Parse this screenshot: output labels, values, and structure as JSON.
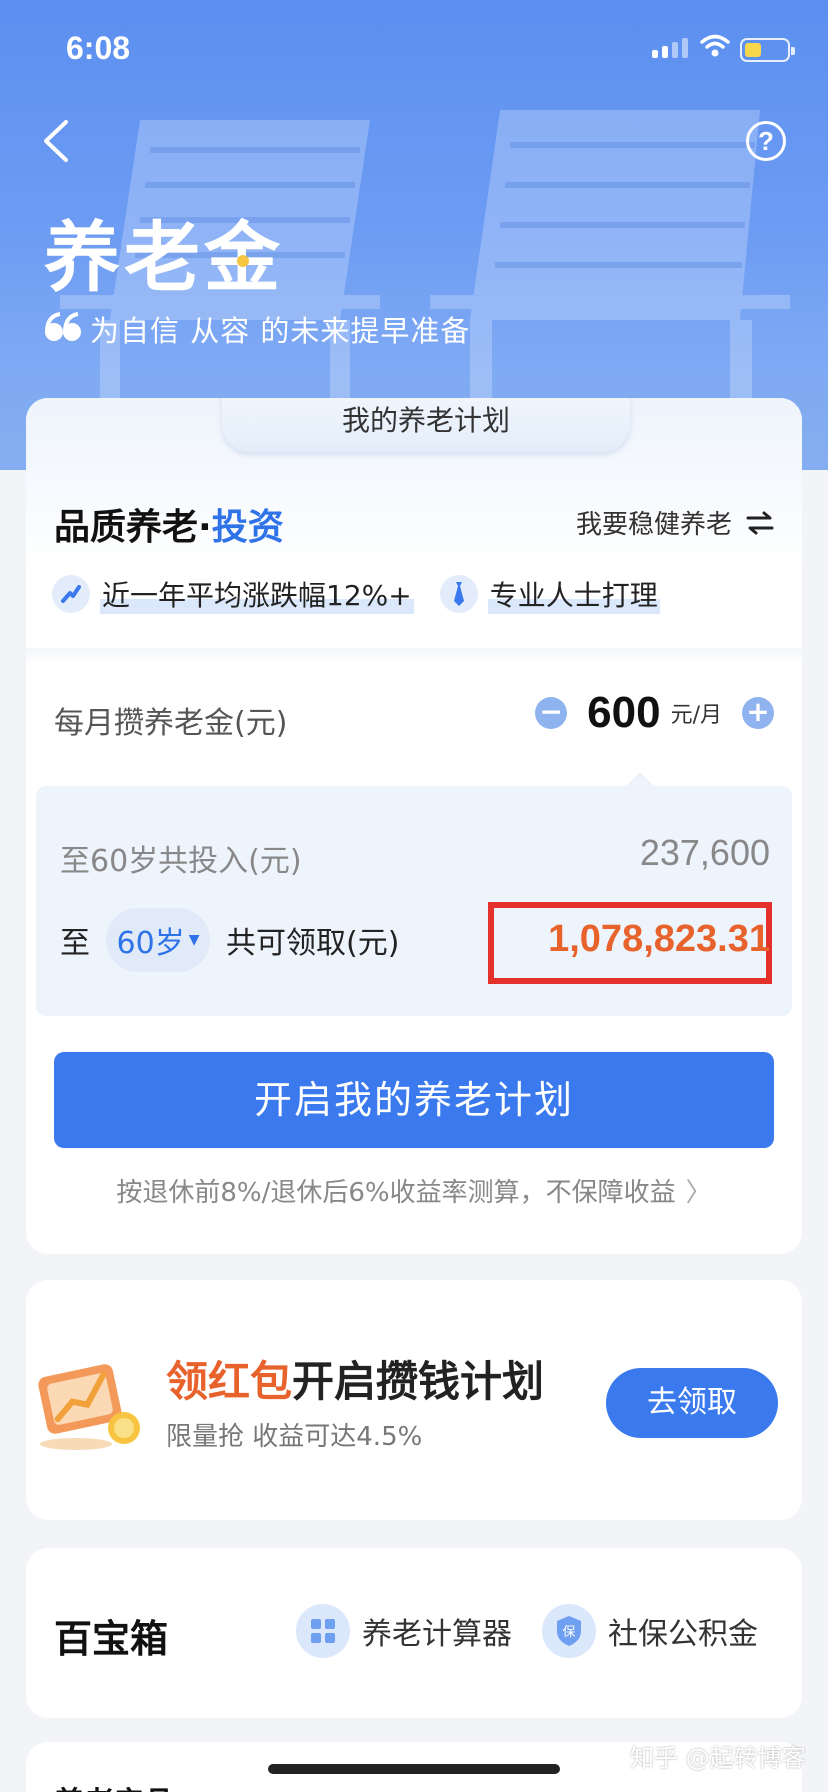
{
  "status_bar": {
    "time": "6:08"
  },
  "header": {
    "title": "养老金",
    "slogan": "为自信 从容 的未来提早准备"
  },
  "plan": {
    "tab_label": "我的养老计划",
    "title_prefix": "品质养老",
    "title_dot": "·",
    "title_accent": "投资",
    "switch_label": "我要稳健养老",
    "features": [
      {
        "icon": "trend-icon",
        "text": "近一年平均涨跌幅12%+"
      },
      {
        "icon": "tie-icon",
        "text": "专业人士打理"
      }
    ],
    "monthly_label": "每月攒养老金(元)",
    "monthly_value": "600",
    "monthly_unit": "元/月",
    "invest_label": "至60岁共投入(元)",
    "invest_value": "237,600",
    "receive_prefix": "至",
    "age_value": "60岁",
    "receive_label": "共可领取(元)",
    "receive_value": "1,078,823.31",
    "start_button": "开启我的养老计划",
    "disclaimer": "按退休前8%/退休后6%收益率测算，不保障收益"
  },
  "promo": {
    "title_red": "领红包",
    "title_rest": "开启攒钱计划",
    "subtitle": "限量抢 收益可达4.5%",
    "button": "去领取"
  },
  "toolbox": {
    "title": "百宝箱",
    "tools": [
      {
        "icon": "grid-icon",
        "label": "养老计算器"
      },
      {
        "icon": "shield-icon",
        "label": "社保公积金",
        "icon_text": "保"
      }
    ]
  },
  "next_section": {
    "title": "养老产品"
  },
  "watermark": "知乎 @起转博客",
  "colors": {
    "primary": "#3a7aee",
    "accent_orange": "#e8622c",
    "highlight_red": "#e5312c",
    "hero_blue": "#5b8ff0"
  }
}
